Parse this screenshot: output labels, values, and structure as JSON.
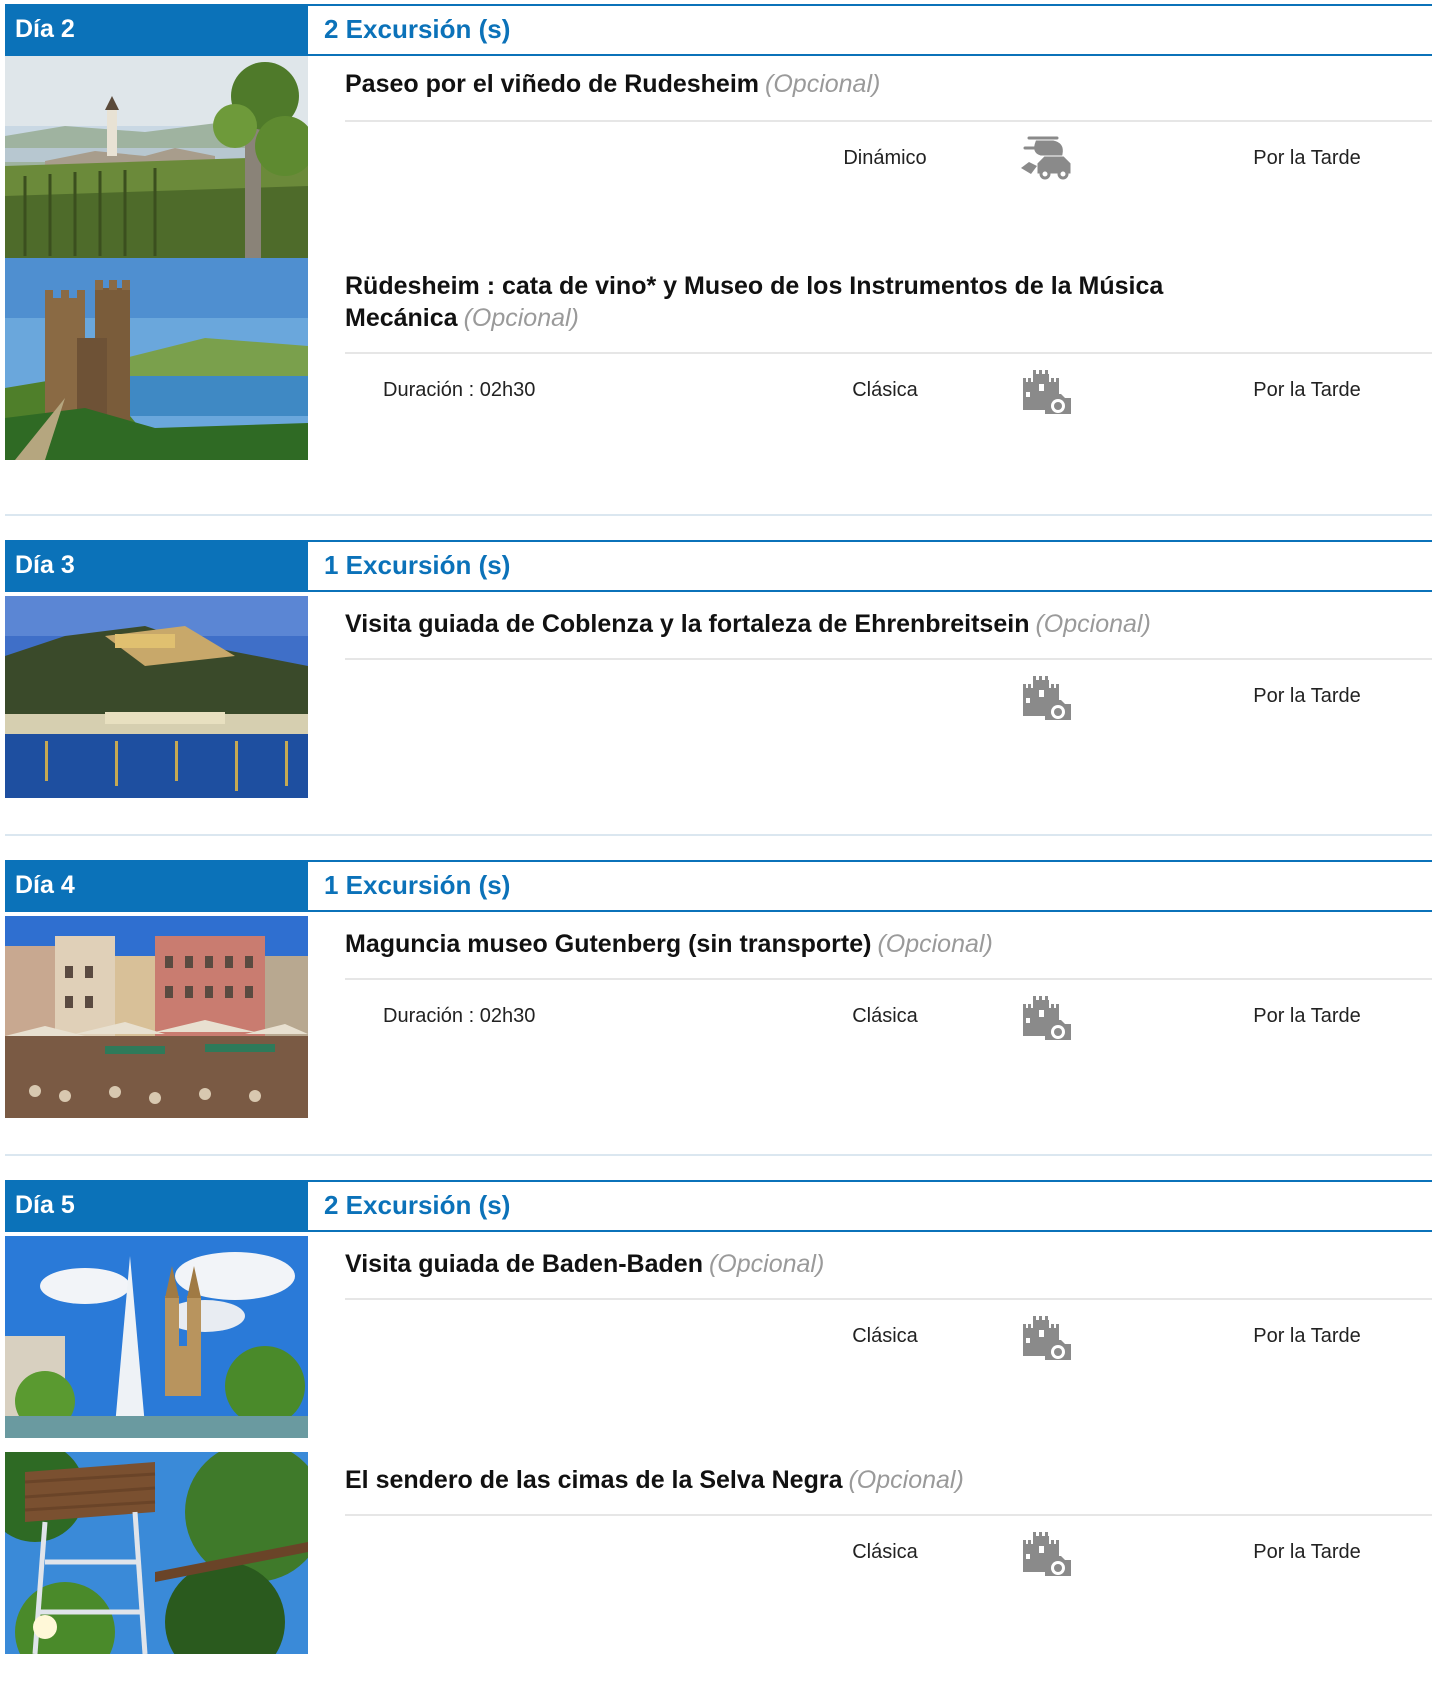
{
  "days": [
    {
      "label": "Día 2",
      "count": "2 Excursión (s)",
      "excursions": [
        {
          "title": "Paseo por el viñedo de Rudesheim",
          "optional": "(Opcional)",
          "duration": "",
          "type": "Dinámico",
          "icon": "helicopter-car-icon",
          "time": "Por la Tarde",
          "image": "vineyard-village-photo"
        },
        {
          "title": "Rüdesheim : cata de vino* y Museo de los Instrumentos de la Música Mecánica",
          "optional": "(Opcional)",
          "duration": "Duración : 02h30",
          "type": "Clásica",
          "icon": "castle-camera-icon",
          "time": "Por la Tarde",
          "image": "castle-ruin-river-photo"
        }
      ]
    },
    {
      "label": "Día 3",
      "count": "1 Excursión (s)",
      "excursions": [
        {
          "title": "Visita guiada de Coblenza y la fortaleza de Ehrenbreitsein",
          "optional": "(Opcional)",
          "duration": "",
          "type": "",
          "icon": "castle-camera-icon",
          "time": "Por la Tarde",
          "image": "fortress-night-river-photo"
        }
      ]
    },
    {
      "label": "Día 4",
      "count": "1 Excursión (s)",
      "excursions": [
        {
          "title": "Maguncia museo Gutenberg (sin transporte)",
          "optional": "(Opcional)",
          "duration": "Duración : 02h30",
          "type": "Clásica",
          "icon": "castle-camera-icon",
          "time": "Por la Tarde",
          "image": "market-square-photo"
        }
      ]
    },
    {
      "label": "Día 5",
      "count": "2 Excursión (s)",
      "excursions": [
        {
          "title": "Visita guiada de Baden-Baden",
          "optional": "(Opcional)",
          "duration": "",
          "type": "Clásica",
          "icon": "castle-camera-icon",
          "time": "Por la Tarde",
          "image": "fountain-church-photo"
        },
        {
          "title": "El sendero de las cimas de la Selva Negra",
          "optional": "(Opcional)",
          "duration": "",
          "type": "Clásica",
          "icon": "castle-camera-icon",
          "time": "Por la Tarde",
          "image": "treetop-tower-photo"
        }
      ]
    }
  ]
}
